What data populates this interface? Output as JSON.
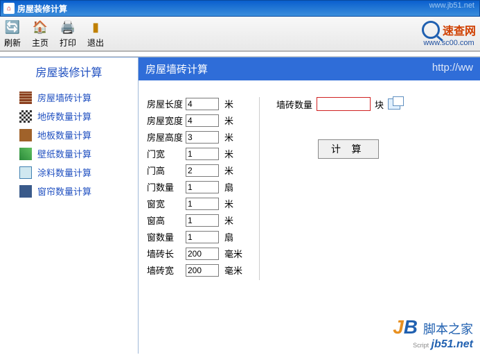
{
  "window": {
    "title": "房屋装修计算"
  },
  "watermark_top": "www.jb51.net",
  "toolbar": {
    "refresh": "刷新",
    "home": "主页",
    "print": "打印",
    "exit": "退出"
  },
  "search_logo": {
    "text": "速查网",
    "url": "www.sc00.com"
  },
  "sidebar": {
    "title": "房屋装修计算",
    "items": [
      {
        "label": "房屋墙砖计算"
      },
      {
        "label": "地砖数量计算"
      },
      {
        "label": "地板数量计算"
      },
      {
        "label": "壁纸数量计算"
      },
      {
        "label": "涂料数量计算"
      },
      {
        "label": "窗帘数量计算"
      }
    ]
  },
  "content": {
    "title": "房屋墙砖计算",
    "url": "http://ww",
    "fields": {
      "room_length": {
        "label": "房屋长度",
        "value": "4",
        "unit": "米"
      },
      "room_width": {
        "label": "房屋宽度",
        "value": "4",
        "unit": "米"
      },
      "room_height": {
        "label": "房屋高度",
        "value": "3",
        "unit": "米"
      },
      "door_width": {
        "label": "门宽",
        "value": "1",
        "unit": "米"
      },
      "door_height": {
        "label": "门高",
        "value": "2",
        "unit": "米"
      },
      "door_count": {
        "label": "门数量",
        "value": "1",
        "unit": "扇"
      },
      "window_width": {
        "label": "窗宽",
        "value": "1",
        "unit": "米"
      },
      "window_height": {
        "label": "窗高",
        "value": "1",
        "unit": "米"
      },
      "window_count": {
        "label": "窗数量",
        "value": "1",
        "unit": "扇"
      },
      "tile_length": {
        "label": "墙砖长",
        "value": "200",
        "unit": "毫米"
      },
      "tile_width": {
        "label": "墙砖宽",
        "value": "200",
        "unit": "毫米"
      }
    },
    "result": {
      "label": "墙砖数量",
      "unit": "块"
    },
    "calc_button": "计 算"
  },
  "footer_logo": {
    "brand_cn": "脚本之家",
    "script": "Script",
    "url": "jb51.net"
  }
}
